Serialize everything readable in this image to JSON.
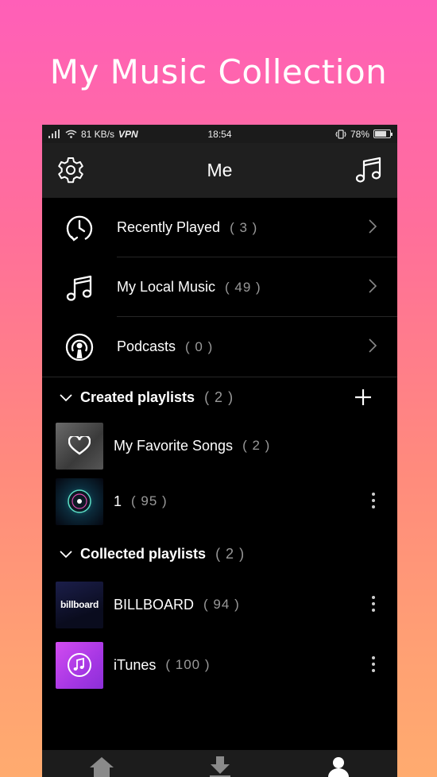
{
  "promo": {
    "title": "My Music Collection"
  },
  "status": {
    "speed": "81 KB/s",
    "vpn": "VPN",
    "time": "18:54",
    "battery": "78%",
    "battery_level": 0.78
  },
  "header": {
    "title": "Me",
    "left_icon": "gear-icon",
    "right_icon": "music-note-icon"
  },
  "menu": [
    {
      "label": "Recently Played",
      "count": "( 3 )",
      "icon": "clock-icon"
    },
    {
      "label": "My Local Music",
      "count": "( 49 )",
      "icon": "music-note-icon"
    },
    {
      "label": "Podcasts",
      "count": "( 0 )",
      "icon": "podcast-icon"
    }
  ],
  "created": {
    "label": "Created playlists",
    "count": "( 2 )",
    "items": [
      {
        "label": "My Favorite Songs",
        "count": "( 2 )"
      },
      {
        "label": "1",
        "count": "( 95 )"
      }
    ]
  },
  "collected": {
    "label": "Collected playlists",
    "count": "( 2 )",
    "items": [
      {
        "label": "BILLBOARD",
        "count": "( 94 )",
        "thumb_text": "billboard"
      },
      {
        "label": "iTunes",
        "count": "( 100 )"
      }
    ]
  },
  "nav": [
    {
      "icon": "home-icon"
    },
    {
      "icon": "download-icon"
    },
    {
      "icon": "profile-icon"
    }
  ],
  "colors": {
    "accent_gradient_top": "#ff5fb8",
    "accent_gradient_bottom": "#ffab6f",
    "itunes": "#b53de6"
  }
}
